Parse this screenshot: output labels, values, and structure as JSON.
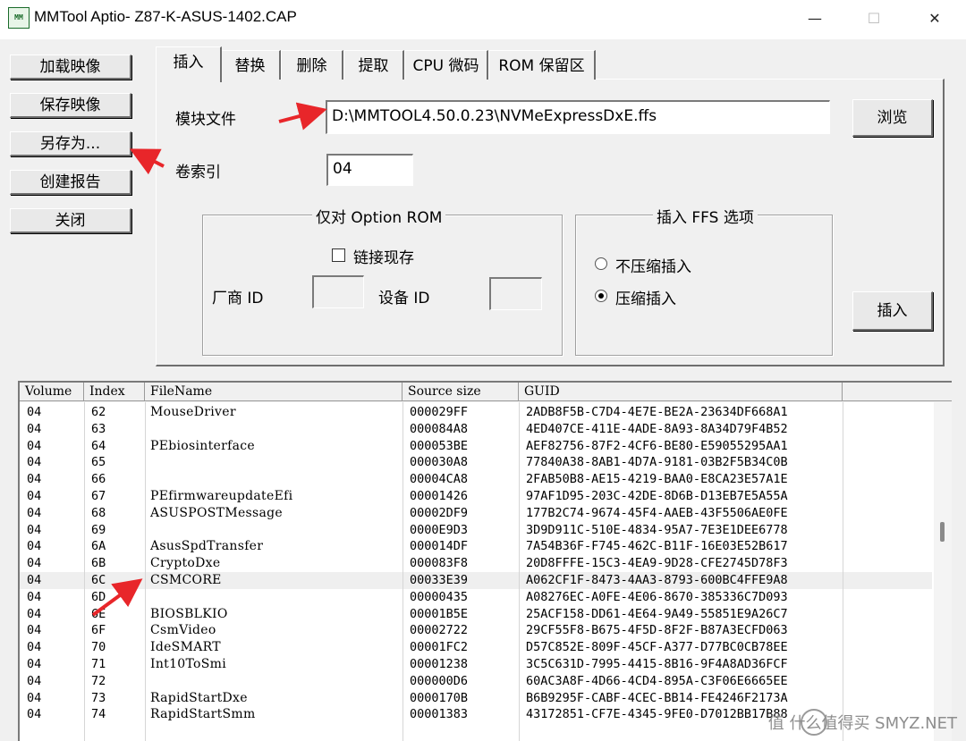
{
  "window": {
    "title": "MMTool Aptio- Z87-K-ASUS-1402.CAP",
    "icon_text": "MM",
    "controls": {
      "minimize": "—",
      "maximize": "☐",
      "close": "✕"
    }
  },
  "left_buttons": [
    {
      "label": "加载映像"
    },
    {
      "label": "保存映像"
    },
    {
      "label": "另存为..."
    },
    {
      "label": "创建报告"
    },
    {
      "label": "关闭"
    }
  ],
  "tabs": [
    {
      "label": "插入",
      "active": true
    },
    {
      "label": "替换",
      "active": false
    },
    {
      "label": "删除",
      "active": false
    },
    {
      "label": "提取",
      "active": false
    },
    {
      "label": "CPU 微码",
      "active": false
    },
    {
      "label": "ROM 保留区",
      "active": false
    }
  ],
  "insert_panel": {
    "module_file_label": "模块文件",
    "module_file_value": "D:\\MMTOOL4.50.0.23\\NVMeExpressDxE.ffs",
    "browse_label": "浏览",
    "volume_index_label": "卷索引",
    "volume_index_value": "04",
    "option_rom_group": {
      "title": "仅对 Option ROM",
      "link_existing_label": "链接现存",
      "link_existing_checked": false,
      "vendor_id_label": "厂商 ID",
      "vendor_id_value": "",
      "device_id_label": "设备 ID",
      "device_id_value": ""
    },
    "ffs_options_group": {
      "title": "插入 FFS 选项",
      "uncompressed_label": "不压缩插入",
      "compressed_label": "压缩插入",
      "selected": "compressed"
    },
    "insert_button_label": "插入"
  },
  "table": {
    "columns": [
      "Volume",
      "Index",
      "FileName",
      "Source size",
      "GUID"
    ],
    "rows": [
      [
        "04",
        "62",
        "MouseDriver",
        "000029FF",
        "2ADB8F5B-C7D4-4E7E-BE2A-23634DF668A1"
      ],
      [
        "04",
        "63",
        "",
        "000084A8",
        "4ED407CE-411E-4ADE-8A93-8A34D79F4B52"
      ],
      [
        "04",
        "64",
        "PEbiosinterface",
        "000053BE",
        "AEF82756-87F2-4CF6-BE80-E59055295AA1"
      ],
      [
        "04",
        "65",
        "",
        "000030A8",
        "77840A38-8AB1-4D7A-9181-03B2F5B34C0B"
      ],
      [
        "04",
        "66",
        "",
        "00004CA8",
        "2FAB50B8-AE15-4219-BAA0-E8CA23E57A1E"
      ],
      [
        "04",
        "67",
        "PEfirmwareupdateEfi",
        "00001426",
        "97AF1D95-203C-42DE-8D6B-D13EB7E5A55A"
      ],
      [
        "04",
        "68",
        "ASUSPOSTMessage",
        "00002DF9",
        "177B2C74-9674-45F4-AAEB-43F5506AE0FE"
      ],
      [
        "04",
        "69",
        "",
        "0000E9D3",
        "3D9D911C-510E-4834-95A7-7E3E1DEE6778"
      ],
      [
        "04",
        "6A",
        "AsusSpdTransfer",
        "000014DF",
        "7A54B36F-F745-462C-B11F-16E03E52B617"
      ],
      [
        "04",
        "6B",
        "CryptoDxe",
        "000083F8",
        "20D8FFFE-15C3-4EA9-9D28-CFE2745D78F3"
      ],
      [
        "04",
        "6C",
        "CSMCORE",
        "00033E39",
        "A062CF1F-8473-4AA3-8793-600BC4FFE9A8"
      ],
      [
        "04",
        "6D",
        "",
        "00000435",
        "A08276EC-A0FE-4E06-8670-385336C7D093"
      ],
      [
        "04",
        "6E",
        "BIOSBLKIO",
        "00001B5E",
        "25ACF158-DD61-4E64-9A49-55851E9A26C7"
      ],
      [
        "04",
        "6F",
        "CsmVideo",
        "00002722",
        "29CF55F8-B675-4F5D-8F2F-B87A3ECFD063"
      ],
      [
        "04",
        "70",
        "IdeSMART",
        "00001FC2",
        "D57C852E-809F-45CF-A377-D77BC0CB78EE"
      ],
      [
        "04",
        "71",
        "Int10ToSmi",
        "00001238",
        "3C5C631D-7995-4415-8B16-9F4A8AD36FCF"
      ],
      [
        "04",
        "72",
        "",
        "000000D6",
        "60AC3A8F-4D66-4CD4-895A-C3F06E6665EE"
      ],
      [
        "04",
        "73",
        "RapidStartDxe",
        "0000170B",
        "B6B9295F-CABF-4CEC-BB14-FE4246F2173A"
      ],
      [
        "04",
        "74",
        "RapidStartSmm",
        "00001383",
        "43172851-CF7E-4345-9FE0-D7012BB17B88"
      ]
    ],
    "highlighted_row": 10
  },
  "watermark": "值 什么值得买 SMYZ.NET",
  "colors": {
    "annotation_arrow": "#e8262a"
  }
}
